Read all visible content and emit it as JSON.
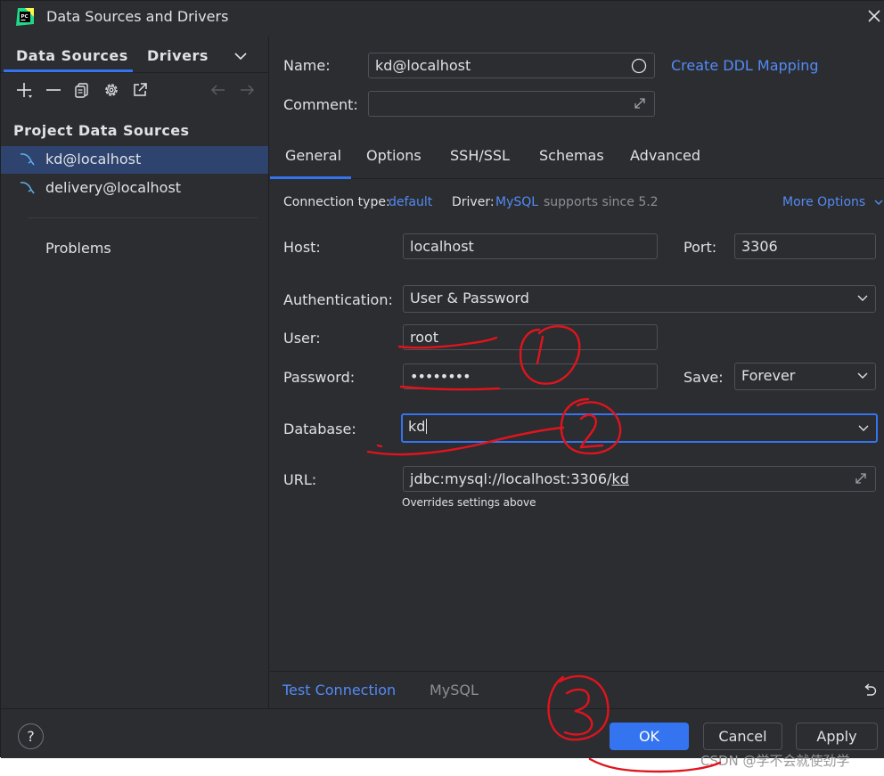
{
  "window": {
    "title": "Data Sources and Drivers"
  },
  "left": {
    "tabs": [
      "Data Sources",
      "Drivers"
    ],
    "section_title": "Project Data Sources",
    "items": [
      {
        "label": "kd@localhost",
        "selected": true
      },
      {
        "label": "delivery@localhost",
        "selected": false
      }
    ],
    "problems_label": "Problems",
    "toolbar_icons": [
      "add-icon",
      "remove-icon",
      "copy-icon",
      "settings-icon",
      "export-icon",
      "back-arrow-icon",
      "forward-arrow-icon"
    ]
  },
  "form": {
    "name_label": "Name:",
    "name_value": "kd@localhost",
    "create_ddl_link": "Create DDL Mapping",
    "comment_label": "Comment:",
    "comment_value": "",
    "tabs": [
      "General",
      "Options",
      "SSH/SSL",
      "Schemas",
      "Advanced"
    ],
    "active_tab": "General",
    "connection_type_label": "Connection type:",
    "connection_type_value": "default",
    "driver_label": "Driver:",
    "driver_value": "MySQL",
    "driver_note": "supports since 5.2",
    "more_options": "More Options",
    "host_label": "Host:",
    "host_value": "localhost",
    "port_label": "Port:",
    "port_value": "3306",
    "auth_label": "Authentication:",
    "auth_value": "User & Password",
    "user_label": "User:",
    "user_value": "root",
    "password_label": "Password:",
    "password_value": "••••••••",
    "save_label": "Save:",
    "save_value": "Forever",
    "database_label": "Database:",
    "database_value": "kd",
    "url_label": "URL:",
    "url_prefix": "jdbc:mysql://localhost:3306/",
    "url_suffix": "kd",
    "url_note": "Overrides settings above"
  },
  "bottom_strip": {
    "test_connection": "Test Connection",
    "driver_name": "MySQL"
  },
  "footer": {
    "help": "?",
    "ok": "OK",
    "cancel": "Cancel",
    "apply": "Apply"
  },
  "watermark": "CSDN @学不会就使劲学",
  "colors": {
    "background": "#2b2d30",
    "accent": "#3574f0",
    "link": "#548af7",
    "selection": "#2e436e",
    "annotation": "#e0141e"
  }
}
